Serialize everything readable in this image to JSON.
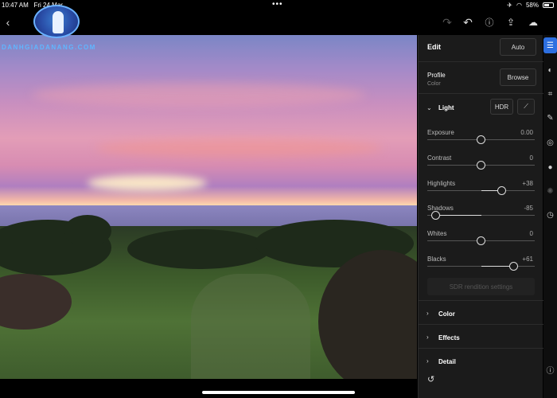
{
  "status": {
    "time": "10:47 AM",
    "date": "Fri 24 Mar",
    "battery": "58%"
  },
  "watermark": "DANHGIADANANG.COM",
  "panel": {
    "title": "Edit",
    "auto_label": "Auto",
    "profile_label": "Profile",
    "profile_value": "Color",
    "browse_label": "Browse",
    "light_label": "Light",
    "hdr_label": "HDR",
    "sliders": [
      {
        "label": "Exposure",
        "value": "0.00",
        "fraction": 0.5
      },
      {
        "label": "Contrast",
        "value": "0",
        "fraction": 0.5
      },
      {
        "label": "Highlights",
        "value": "+38",
        "fraction": 0.69
      },
      {
        "label": "Shadows",
        "value": "-85",
        "fraction": 0.075
      },
      {
        "label": "Whites",
        "value": "0",
        "fraction": 0.5
      },
      {
        "label": "Blacks",
        "value": "+61",
        "fraction": 0.805
      }
    ],
    "sdr_label": "SDR rendition settings",
    "sections": [
      "Color",
      "Effects",
      "Detail"
    ]
  },
  "colors": {
    "accent": "#2d6fe0",
    "panel_bg": "#1b1b1b"
  },
  "icons": [
    "back-icon",
    "redo-icon",
    "undo-icon",
    "help-icon",
    "share-icon",
    "cloud-icon",
    "adjust-icon",
    "preset-icon",
    "crop-icon",
    "heal-icon",
    "mask-icon",
    "blur-icon",
    "lens-icon",
    "versions-icon",
    "info-icon",
    "reset-icon"
  ]
}
